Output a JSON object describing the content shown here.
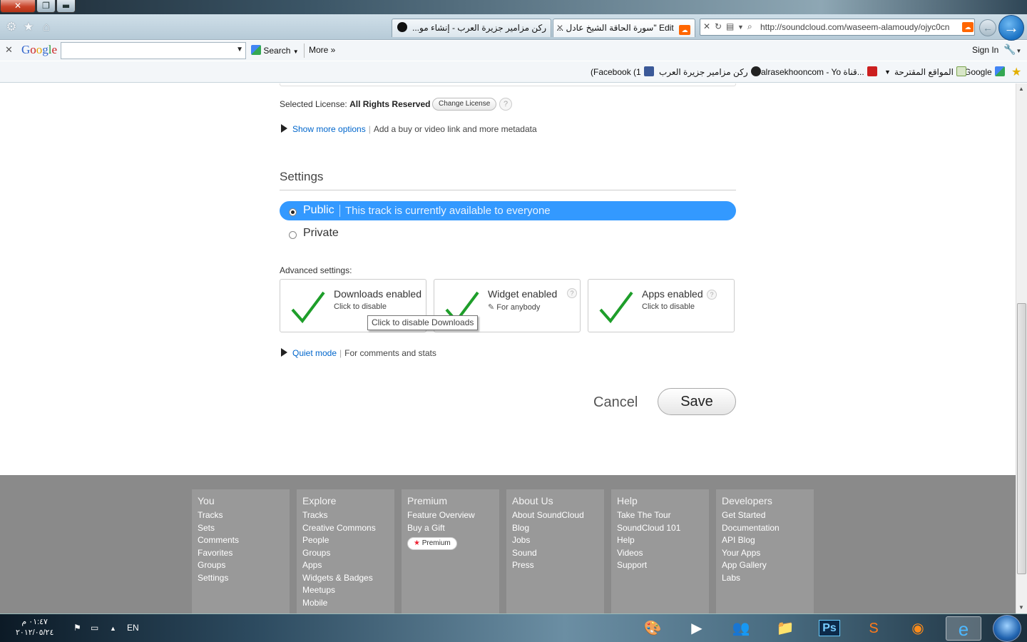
{
  "window": {
    "close_glyph": "✕",
    "restore_glyph": "❐",
    "min_glyph": "▬"
  },
  "browser": {
    "tabs": [
      {
        "title": "رکن مزامیر جزیرة العرب - إنشاء مو..."
      },
      {
        "title": "Edit \"سورة الحاقة الشيخ عادل ..."
      }
    ],
    "url": "http://soundcloud.com/waseem-alamoudy/ojyc0cn"
  },
  "googlebar": {
    "logo": "Google",
    "search_value": "",
    "search_label": "Search",
    "more_label": "More",
    "signin_label": "Sign In"
  },
  "favorites": [
    {
      "label": "Google",
      "color": "#4285f4"
    },
    {
      "label": "المواقع المقترحة",
      "color": "#7aa34e"
    },
    {
      "label": "alrasekhooncom - Yo قناة...",
      "color": "#cc1f1f"
    },
    {
      "label": "رکن مزامیر جزیرة العرب",
      "color": "#222222"
    },
    {
      "label": "(Facebook (1",
      "color": "#3b5998"
    }
  ],
  "license": {
    "prefix": "Selected License:",
    "value": "All Rights Reserved",
    "change_label": "Change License",
    "help": "?"
  },
  "more_options": {
    "link": "Show more options",
    "desc": "Add a buy or video link and more metadata"
  },
  "settings": {
    "title": "Settings",
    "public_label": "Public",
    "public_desc": "This track is currently available to everyone",
    "private_label": "Private",
    "advanced_label": "Advanced settings:",
    "advanced": [
      {
        "title": "Downloads enabled",
        "sub": "Click to disable",
        "enabled": true
      },
      {
        "title": "Widget enabled",
        "sub": "For anybody",
        "enabled": true
      },
      {
        "title": "Apps enabled",
        "sub": "Click to disable",
        "enabled": true
      }
    ],
    "tooltip": "Click to disable Downloads",
    "quiet_link": "Quiet mode",
    "quiet_desc": "For comments and stats"
  },
  "actions": {
    "cancel": "Cancel",
    "save": "Save"
  },
  "footer": {
    "columns": [
      {
        "title": "You",
        "links": [
          "Tracks",
          "Sets",
          "Comments",
          "Favorites",
          "Groups",
          "Settings"
        ]
      },
      {
        "title": "Explore",
        "links": [
          "Tracks",
          "Creative Commons",
          "People",
          "Groups",
          "Apps",
          "Widgets & Badges",
          "Meetups",
          "Mobile"
        ]
      },
      {
        "title": "Premium",
        "links": [
          "Feature Overview",
          "Buy a Gift"
        ]
      },
      {
        "title": "About Us",
        "links": [
          "About SoundCloud",
          "Blog",
          "Jobs",
          "Sound",
          "Press"
        ]
      },
      {
        "title": "Help",
        "links": [
          "Take The Tour",
          "SoundCloud 101",
          "Help",
          "Videos",
          "Support"
        ]
      },
      {
        "title": "Developers",
        "links": [
          "Get Started",
          "Documentation",
          "API Blog",
          "Your Apps",
          "App Gallery",
          "Labs"
        ]
      }
    ],
    "premium_badge": "Premium"
  },
  "taskbar": {
    "time": "٠١:٤٧ م",
    "date": "٢٠١٢/٠٥/٢٤",
    "lang": "EN"
  }
}
